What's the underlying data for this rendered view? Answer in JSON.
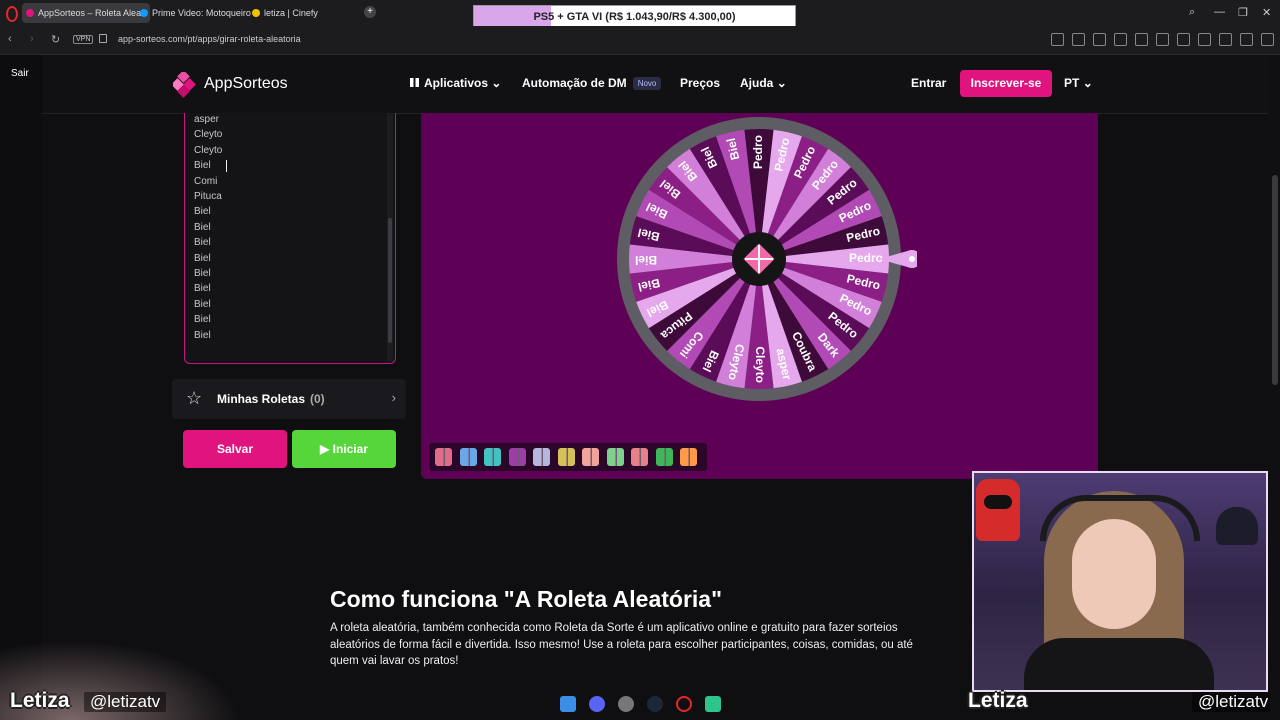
{
  "browser": {
    "tabs": [
      {
        "title": "AppSorteos – Roleta Alea",
        "active": true,
        "color": "#e0137f"
      },
      {
        "title": "Prime Video: Motoqueiro",
        "active": false,
        "color": "#1399ff"
      },
      {
        "title": "letiza | Cinefy",
        "active": false,
        "color": "#f2c200"
      }
    ],
    "new_tab_label": "+",
    "promo_text": "PS5 + GTA VI (R$ 1.043,90/R$ 4.300,00)",
    "promo_progress": 0.24,
    "vpn_label": "VPN",
    "url": "app-sorteos.com/pt/apps/girar-roleta-aleatoria",
    "win_min": "—",
    "win_max": "❐",
    "win_close": "✕"
  },
  "sidebar": {
    "exit_label": "Sair"
  },
  "site": {
    "brand": "AppSorteos",
    "nav": {
      "apps": "Aplicativos",
      "dm": "Automação de DM",
      "dm_badge": "Novo",
      "pricing": "Preços",
      "help": "Ajuda",
      "login": "Entrar",
      "signup": "Inscrever-se",
      "lang": "PT"
    }
  },
  "entries_list": [
    "asper",
    "Cleyto",
    "Cleyto",
    "Biel",
    "Comi",
    "Pituca",
    "Biel",
    "Biel",
    "Biel",
    "Biel",
    "Biel",
    "Biel",
    "Biel",
    "Biel",
    "Biel"
  ],
  "my_wheels": {
    "label": "Minhas Roletas",
    "count": "(0)"
  },
  "buttons": {
    "save": "Salvar",
    "start": "Iniciar"
  },
  "wheel": {
    "segments": [
      "Biel",
      "Biel",
      "Biel",
      "Biel",
      "Pedro",
      "Pedro",
      "Pedro",
      "Pedro",
      "Pedro",
      "Pedro",
      "Pedro",
      "Pedro",
      "Pedro",
      "Pedro",
      "Pedro",
      "Dark",
      "Coubra",
      "asper",
      "Cleyto",
      "Cleyto",
      "Biel",
      "Comi",
      "Pituca",
      "Biel",
      "Biel",
      "Biel",
      "Biel",
      "Biel"
    ],
    "colors": [
      "#8c1f86",
      "#d27fd9",
      "#5b0c58",
      "#b24ab6",
      "#3d0a3a",
      "#e6a8ec"
    ]
  },
  "palette": [
    "#e06b8a",
    "#6aa7e8",
    "#43c2c2",
    "#9a3fa8",
    "#b6b6de",
    "#d6c05a",
    "#f2a49a",
    "#7fcf8f",
    "#e8808a",
    "#3fb65a",
    "#ff9a4a"
  ],
  "content": {
    "heading": "Como funciona \"A Roleta Aleatória\"",
    "paragraph": "A roleta aleatória, também conhecida como Roleta da Sorte é um aplicativo online e gratuito para fazer sorteios aleatórios de forma fácil e divertida. Isso mesmo! Use a roleta para escolher participantes, coisas, comidas, ou até quem vai lavar os pratos!"
  },
  "stream_overlay": {
    "name": "Letiza",
    "handle": "@letizatv"
  }
}
